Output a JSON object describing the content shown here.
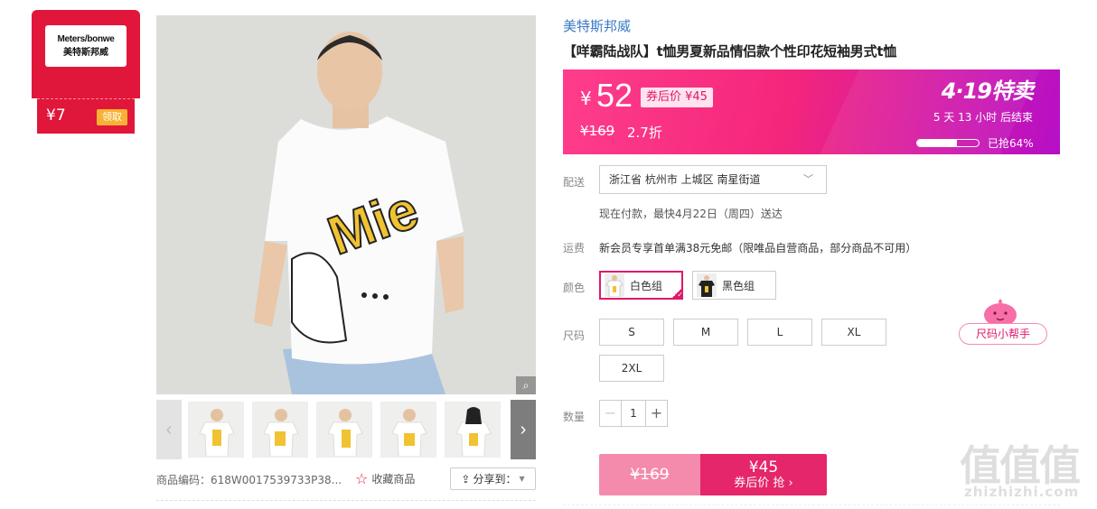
{
  "coupon": {
    "logo_en": "Meters/bonwe",
    "logo_cn": "美特斯邦威",
    "amount": "¥7",
    "claim_label": "领取",
    "color": "#e0173b"
  },
  "gallery": {
    "main_image_alt": "product-model-white-tshirt",
    "zoom_icon": "magnifier-icon",
    "thumbnails": [
      "thumb-1",
      "thumb-2",
      "thumb-3",
      "thumb-4",
      "thumb-5"
    ],
    "prev_icon": "‹",
    "next_icon": "›"
  },
  "meta": {
    "sku": "商品编码：618W0017539733P38...",
    "favorite_label": "收藏商品",
    "share_label": "分享到："
  },
  "product": {
    "brand": "美特斯邦威",
    "title": "【咩霸陆战队】t恤男夏新品情侣款个性印花短袖男式t恤"
  },
  "price": {
    "currency": "¥",
    "current": "52",
    "after_coupon": "券后价 ¥45",
    "original": "¥169",
    "discount": "2.7折",
    "promo_title": "4·19特卖",
    "countdown": "5  天  13  小时  后结束",
    "sold_percent": 64,
    "sold_text": "已抢64%"
  },
  "shipping": {
    "label": "配送",
    "address": "浙江省 杭州市 上城区 南星街道",
    "delivery": "现在付款，最快4月22日（周四）送达"
  },
  "freight": {
    "label": "运费",
    "text": "新会员专享首单满38元免邮（限唯品自营商品，部分商品不可用）"
  },
  "colors": {
    "label": "颜色",
    "options": [
      "白色组",
      "黑色组"
    ],
    "selected": "白色组"
  },
  "sizes": {
    "label": "尺码",
    "options": [
      "S",
      "M",
      "L",
      "XL",
      "2XL"
    ]
  },
  "helper": {
    "label": "尺码小帮手"
  },
  "quantity": {
    "label": "数量",
    "value": "1",
    "minus": "−",
    "plus": "+"
  },
  "buy": {
    "original": "¥169",
    "price": "¥45",
    "sub": "券后价 抢 ›"
  },
  "watermark": {
    "big": "值值值",
    "small": "zhizhizhi.com"
  },
  "colors_theme": {
    "accent": "#e5266a",
    "brand_link": "#3a7ac4"
  }
}
